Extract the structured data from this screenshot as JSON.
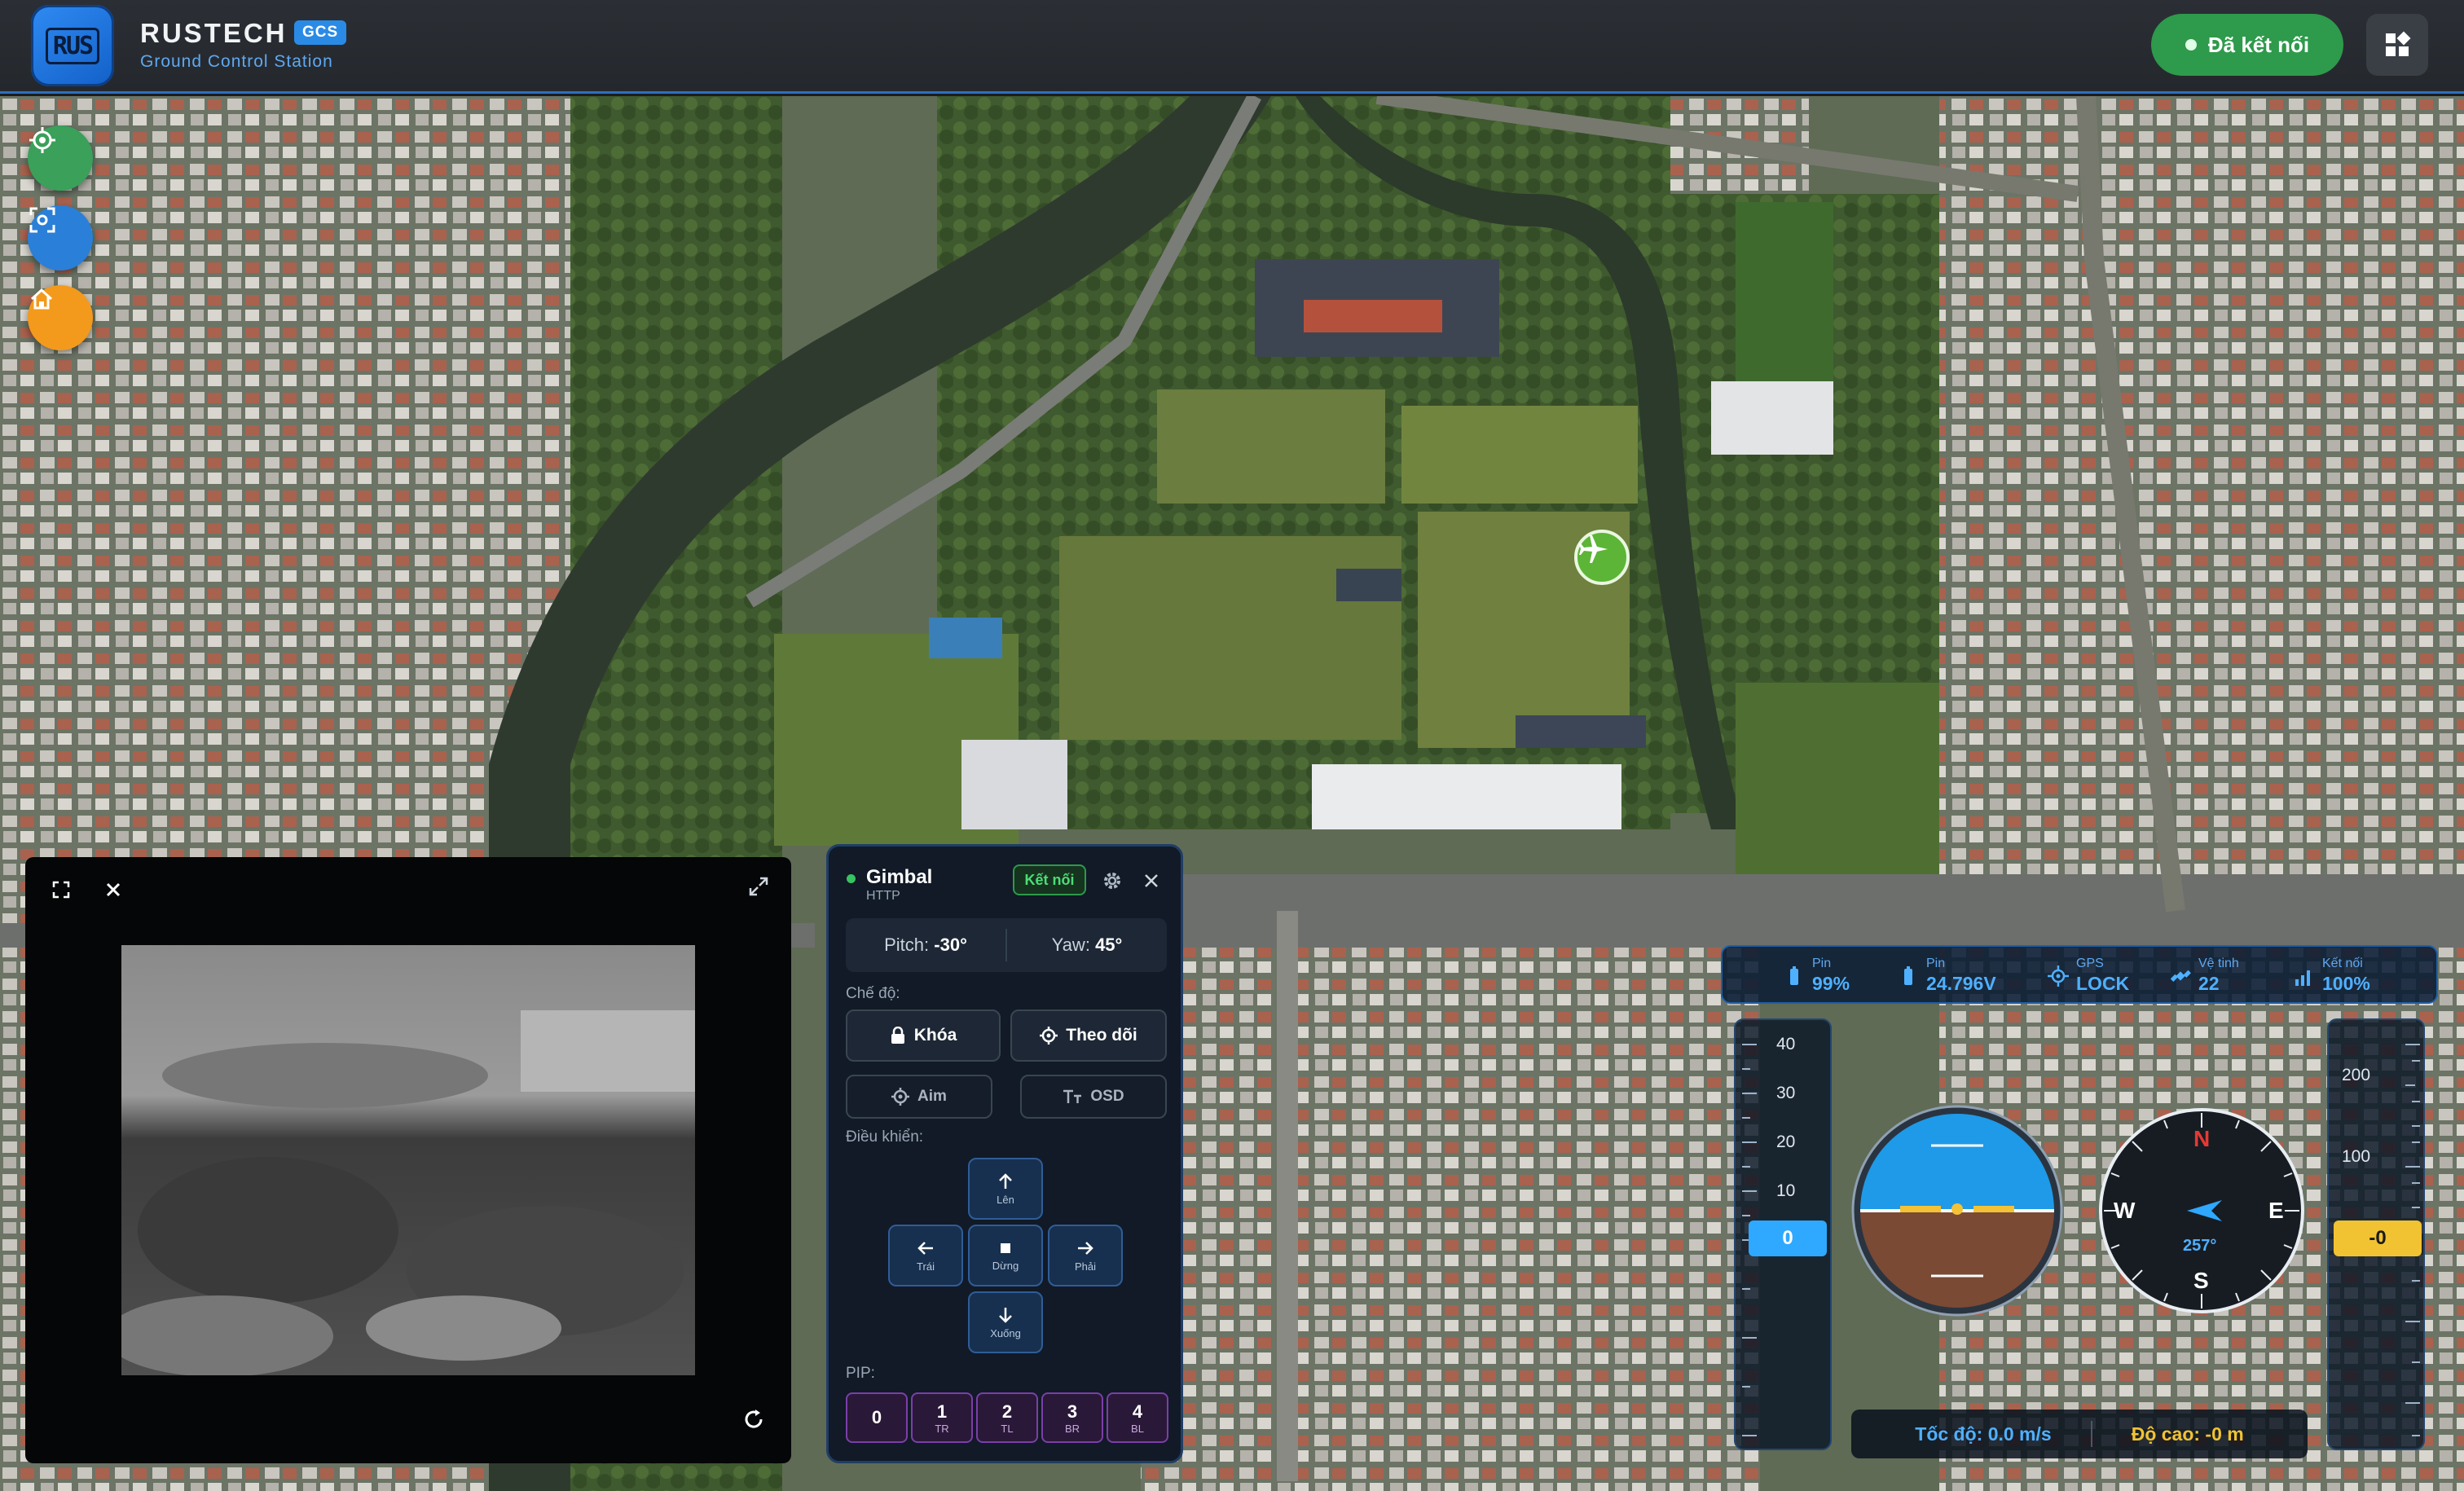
{
  "header": {
    "logo_text": "RUS",
    "brand": "RUSTECH",
    "badge": "GCS",
    "subtitle": "Ground Control Station",
    "connection_label": "Đã kết nối"
  },
  "map": {
    "buttons": [
      "locate-icon",
      "focus-icon",
      "home-icon"
    ]
  },
  "gimbal": {
    "title": "Gimbal",
    "protocol": "HTTP",
    "connect_label": "Kết nối",
    "pitch_label": "Pitch:",
    "pitch_value": "-30°",
    "yaw_label": "Yaw:",
    "yaw_value": "45°",
    "mode_label": "Chế độ:",
    "lock_label": "Khóa",
    "follow_label": "Theo dõi",
    "aim_label": "Aim",
    "osd_label": "OSD",
    "control_label": "Điều khiển:",
    "up_label": "Lên",
    "left_label": "Trái",
    "stop_label": "Dừng",
    "right_label": "Phải",
    "down_label": "Xuống",
    "pip_label": "PIP:",
    "pip": [
      {
        "num": "0",
        "sub": ""
      },
      {
        "num": "1",
        "sub": "TR"
      },
      {
        "num": "2",
        "sub": "TL"
      },
      {
        "num": "3",
        "sub": "BR"
      },
      {
        "num": "4",
        "sub": "BL"
      }
    ]
  },
  "telemetry": {
    "battery_pct_label": "Pin",
    "battery_pct": "99%",
    "battery_v_label": "Pin",
    "battery_v": "24.796V",
    "gps_label": "GPS",
    "gps": "LOCK",
    "sat_label": "Vệ tinh",
    "sat": "22",
    "link_label": "Kết nối",
    "link": "100%",
    "speed_tape": [
      "40",
      "30",
      "20",
      "10"
    ],
    "speed_value": "0",
    "alt_tape": [
      "200",
      "100"
    ],
    "alt_value": "-0",
    "heading": "257°",
    "compass": {
      "n": "N",
      "s": "S",
      "e": "E",
      "w": "W"
    },
    "speed_text": "Tốc độ: 0.0 m/s",
    "alt_text": "Độ cao: -0 m"
  },
  "colors": {
    "accent": "#2a8be6",
    "connected": "#2e9a4b",
    "altitude": "#f1c232",
    "speed": "#4fb0ff",
    "pip": "#7b3fa8"
  }
}
